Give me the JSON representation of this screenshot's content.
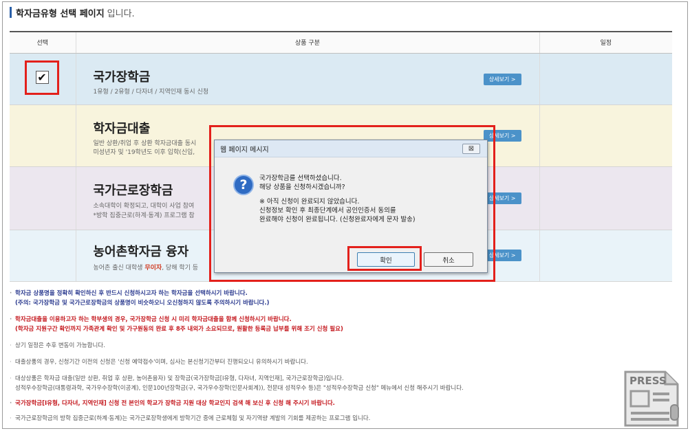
{
  "header": {
    "title_strong": "학자금유형 선택 페이지",
    "title_rest": "입니다."
  },
  "table": {
    "headers": [
      "선택",
      "상품 구분",
      "일정"
    ],
    "rows": [
      {
        "name": "국가장학금",
        "desc1": "1유형 / 2유형 / 다자녀 / 지역인재 동시 신청",
        "desc2": "",
        "detail": "상세보기 >",
        "checked": true
      },
      {
        "name": "학자금대출",
        "desc1": "일반 상환/취업 후 상환 학자금대출 동시",
        "desc2": "미성년자 및 '19학년도 이후 입학(신입,",
        "detail": "상세보기 >",
        "checked": false
      },
      {
        "name": "국가근로장학금",
        "desc1": "소속대학이 확정되고, 대학이 사업 참여",
        "desc2": "*방학 집중근로(하계·동계) 프로그램 참",
        "detail": "상세보기 >",
        "checked": false
      },
      {
        "name": "농어촌학자금 융자",
        "desc1": "농어촌 출신 대학생",
        "desc1_highlight": "무이자",
        "desc1_tail": ", 당해 학기 등",
        "desc2": "",
        "detail": "상세보기 >",
        "checked": false
      }
    ]
  },
  "checkbox_mark": "✔",
  "notes": [
    {
      "bullet": "·",
      "text": "학자금 상품명을 정확히 확인하신 후 반드시 신청하시고자 하는 학자금을 선택하시기 바랍니다.",
      "style": "navy"
    },
    {
      "bullet": "",
      "text": "(주의: 국가장학금 및 국가근로장학금의 상품명이 비슷하오니 오신청하지 않도록 주의하시기 바랍니다.)",
      "style": "navy"
    },
    {
      "bullet": "·",
      "text": "학자금대출을 이용하고자 하는 학부생의 경우, 국가장학금 신청 시 미리 학자금대출을 함께 신청하시기 바랍니다.",
      "style": "red"
    },
    {
      "bullet": "",
      "text": "(학자금 지원구간 확인까지 가족관계 확인 및 가구원동의 완료 후 8주 내외가 소요되므로, 원활한 등록금 납부를 위해 조기 신청 필요)",
      "style": "red"
    },
    {
      "bullet": "·",
      "text": "상기 일정은 추후 변동이 가능합니다.",
      "style": "plain"
    },
    {
      "bullet": "·",
      "text": "대출상품의 경우, 신청기간 이전의 신청은 '신청 예약접수'이며, 심사는 본신청기간부터 진행되오니 유의하시기 바랍니다.",
      "style": "plain"
    },
    {
      "bullet": "·",
      "text": "대상상품은 학자금 대출(일반 상환, 취업 후 상환, 농어촌융자) 및 장학금(국가장학금[Ⅰ유형, 다자녀, 지역인재], 국가근로장학금)입니다.",
      "style": "plain"
    },
    {
      "bullet": "",
      "text": "성적우수장학금(대통령과학, 국가우수장학(이공계), 인문100년장학금(구, 국가우수장학(인문사회계)), 전문대 성적우수 등)은 \"성적우수장학금 신청\" 메뉴에서 신청 해주시기 바랍니다.",
      "style": "plain"
    },
    {
      "bullet": "·",
      "text": "국가장학금[Ⅰ유형, 다자녀, 지역인재] 신청 전 본인의 학교가 장학금 지원 대상 학교인지 검색 해 보신 후 신청 해 주시기 바랍니다.",
      "style": "red"
    },
    {
      "bullet": "·",
      "text": "국가근로장학금의 방학 집중근로(하계·동계)는 국가근로장학생에게 방학기간 중에 근로체험 및 자기역량 계발의 기회를 제공하는 프로그램 입니다.",
      "style": "plain"
    }
  ],
  "dialog": {
    "title": "웹 페이지 메시지",
    "close_label": "⊠",
    "question_mark": "?",
    "lines": [
      "국가장학금를 선택하셨습니다.",
      "해당 상품을 신청하시겠습니까?",
      "",
      "※ 아직 신청이 완료되지 않았습니다.",
      "신청정보 확인 후 최종단계에서 공인인증서 동의를",
      "완료해야 신청이 완료됩니다. (신청완료자에게 문자 발송)"
    ],
    "ok_label": "확인",
    "cancel_label": "취소"
  },
  "watermark": {
    "label": "PRESS"
  },
  "colors": {
    "accent_blue": "#2a5fa8",
    "highlight_red": "#e3201b",
    "detail_button": "#4b92c9"
  }
}
